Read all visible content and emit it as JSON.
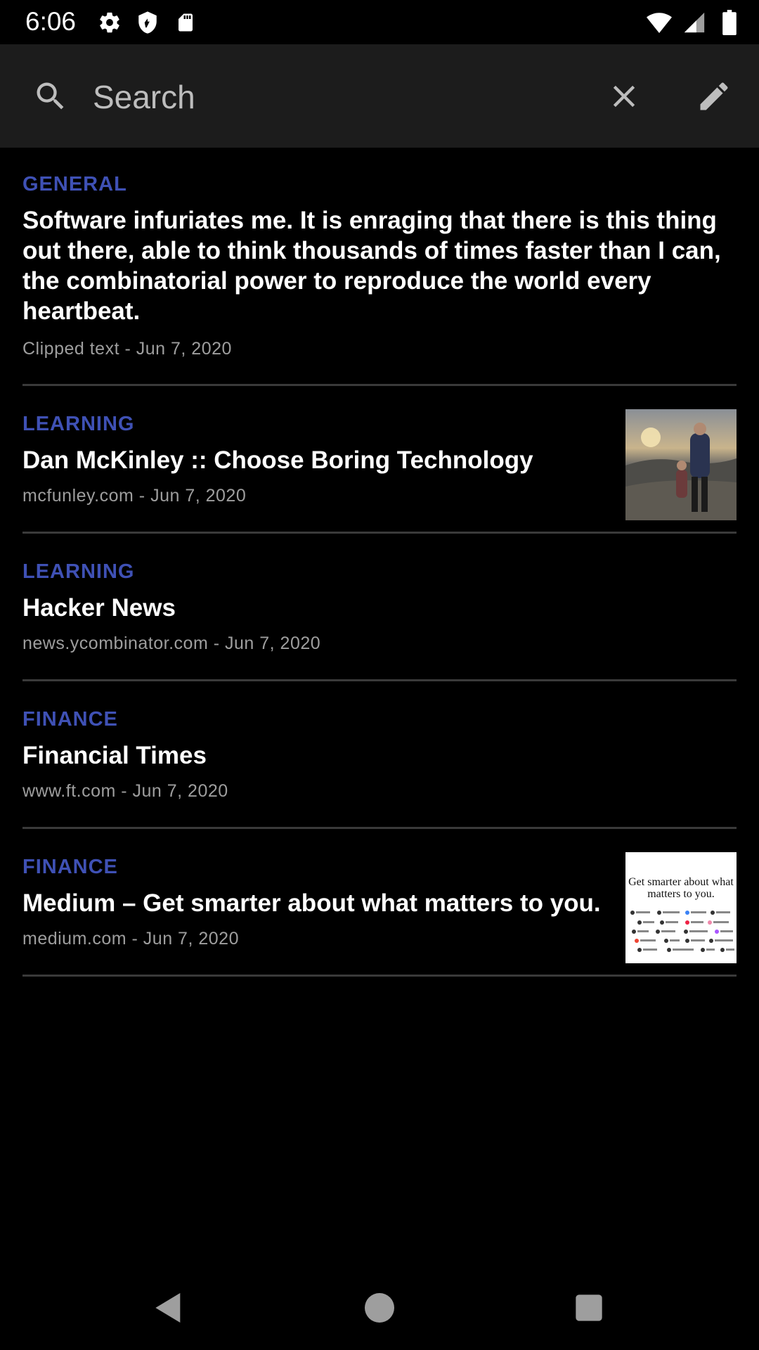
{
  "status_bar": {
    "time": "6:06",
    "left_icons": [
      "settings-icon",
      "shield-icon",
      "sd-card-icon"
    ],
    "right_icons": [
      "wifi-icon",
      "signal-icon",
      "battery-icon"
    ]
  },
  "search": {
    "placeholder": "Search",
    "value": ""
  },
  "colors": {
    "accent": "#3f51b5",
    "background": "#000000",
    "toolbar": "#1c1c1c",
    "divider": "#3a3a3a",
    "meta_text": "#9e9e9e"
  },
  "items": [
    {
      "category": "GENERAL",
      "title": "Software infuriates me. It is enraging that there is this thing out there, able to think thousands of times faster than I can, the combinatorial power to reproduce the world every heartbeat.",
      "meta": "Clipped text - Jun 7, 2020",
      "thumbnail": null
    },
    {
      "category": "LEARNING",
      "title": "Dan McKinley :: Choose Boring Technology",
      "meta": "mcfunley.com - Jun 7, 2020",
      "thumbnail": "photo-thumbnail"
    },
    {
      "category": "LEARNING",
      "title": "Hacker News",
      "meta": "news.ycombinator.com - Jun 7, 2020",
      "thumbnail": null
    },
    {
      "category": "FINANCE",
      "title": "Financial Times",
      "meta": "www.ft.com - Jun 7, 2020",
      "thumbnail": null
    },
    {
      "category": "FINANCE",
      "title": "Medium – Get smarter about what matters to you.",
      "meta": "medium.com - Jun 7, 2020",
      "thumbnail": "medium-thumbnail",
      "thumbnail_text": "Get smarter about what matters to you."
    }
  ],
  "nav": {
    "back": "back-icon",
    "home": "home-icon",
    "recents": "recents-icon"
  }
}
